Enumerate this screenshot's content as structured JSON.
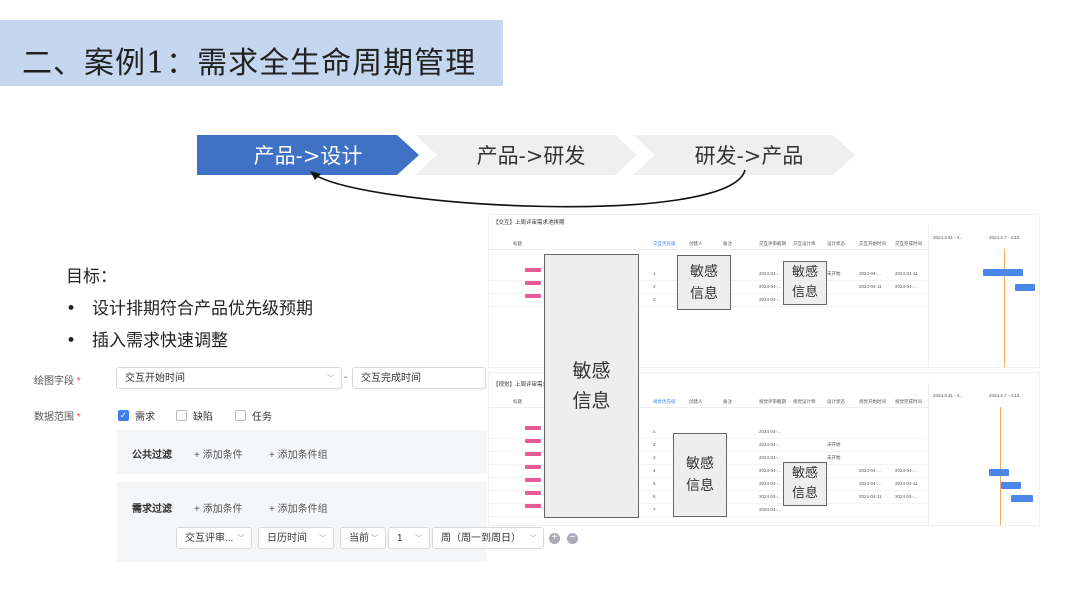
{
  "title": "二、案例1：需求全生命周期管理",
  "steps": [
    "产品->设计",
    "产品->研发",
    "研发->产品"
  ],
  "goal": {
    "heading": "目标：",
    "items": [
      "设计排期符合产品优先级预期",
      "插入需求快速调整"
    ],
    "bullet": "•"
  },
  "form": {
    "field_label": "绘图字段",
    "required_mark": "*",
    "start_field": "交互开始时间",
    "dash": "-",
    "end_field": "交互完成时间",
    "scope_label": "数据范围",
    "scope_options": [
      {
        "label": "需求",
        "checked": true
      },
      {
        "label": "缺陷",
        "checked": false
      },
      {
        "label": "任务",
        "checked": false
      }
    ],
    "public_filter_label": "公共过滤",
    "add_condition": "+ 添加条件",
    "add_condition_group": "+ 添加条件组",
    "req_filter_label": "需求过滤",
    "filter_values": [
      "交互评审...",
      "日历时间",
      "当前",
      "1",
      "周（周一到周日）"
    ],
    "add_icon": "plus-circle-icon",
    "remove_icon": "minus-circle-icon"
  },
  "table1": {
    "title": "【交互】上周评审需求池排期",
    "headers": [
      "标题",
      "交互优先级",
      "创建人",
      "备注",
      "交互评审截期",
      "交互设计师",
      "设计状态",
      "交互开始时间",
      "交互完成时间"
    ],
    "rows": [
      {
        "num": "1",
        "review": "2024-04-...",
        "status": "未开始",
        "start": "2024-04-...",
        "end": "2024-04-11"
      },
      {
        "num": "2",
        "review": "2024-04-...",
        "status": "",
        "start": "2024-04-11",
        "end": "2024-04-..."
      },
      {
        "num": "3",
        "review": "2024-04-...",
        "status": "",
        "start": "",
        "end": ""
      }
    ],
    "gantt_ranges": [
      "2024.3.31 - 4...",
      "2024.4.7 - 4.13"
    ]
  },
  "table2": {
    "title": "【视觉】上周评审需求池排期",
    "headers": [
      "标题",
      "视觉优先级",
      "创建人",
      "备注",
      "视觉评审截期",
      "视觉设计师",
      "设计状态",
      "视觉开始时间",
      "视觉完成时间"
    ],
    "rows": [
      {
        "num": "1",
        "review": "2024-04-...",
        "status": "",
        "start": "",
        "end": ""
      },
      {
        "num": "2",
        "review": "2024-04-...",
        "status": "未开始",
        "start": "",
        "end": ""
      },
      {
        "num": "3",
        "review": "2024-04-...",
        "status": "未开始",
        "start": "",
        "end": ""
      },
      {
        "num": "4",
        "review": "2024-04-...",
        "status": "",
        "start": "2024-04-...",
        "end": "2024-04-..."
      },
      {
        "num": "5",
        "review": "2024-04-...",
        "status": "",
        "start": "2024-04-...",
        "end": "2024-04-11"
      },
      {
        "num": "6",
        "review": "2024-04-...",
        "status": "",
        "start": "2024-04-11",
        "end": "2024-04-..."
      },
      {
        "num": "7",
        "review": "2024-04-...",
        "status": "",
        "start": "",
        "end": ""
      }
    ],
    "gantt_ranges": [
      "2024.3.31 - 4...",
      "2024.4.7 - 4.13"
    ]
  },
  "sensitive": {
    "label1": "敏感",
    "label2": "信息"
  },
  "colors": {
    "accent": "#3f72c4",
    "title_bg": "#c5d7ee",
    "gantt_bar": "#4a86e8",
    "checkbox": "#3c7ef0"
  }
}
